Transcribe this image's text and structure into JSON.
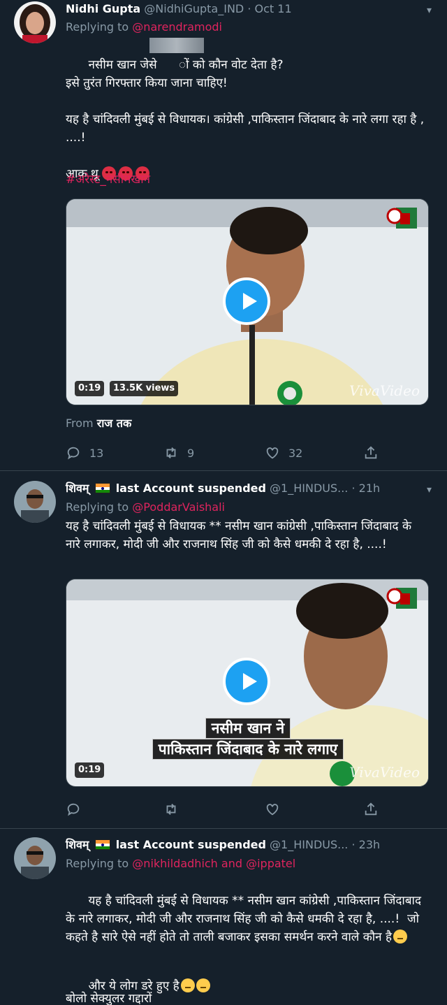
{
  "tweets": [
    {
      "name": "Nidhi Gupta",
      "handle": "@NidhiGupta_IND",
      "sep": "·",
      "time": "Oct 11",
      "replying_prefix": "Replying to ",
      "replying_to": "@narendramodi",
      "text1": "नसीम खान जेसे      ों को कौन वोट देता है?\nइसे तुरंत गिरफ्तार किया जाना चाहिए!\n\nयह है चांदिवली मुंबई से विधायक। कांग्रेसी ,पाकिस्तान जिंदाबाद के नारे लगा रहा है , ....!\n\nआक थू ",
      "hashtag": "#अरेस्ट_नसीमखान",
      "video": {
        "duration": "0:19",
        "views": "13.5K views",
        "watermark": "VivaVideo"
      },
      "from_prefix": "From ",
      "from_source": "राज तक",
      "actions": {
        "replies": "13",
        "retweets": "9",
        "likes": "32"
      }
    },
    {
      "name": "शिवम्",
      "suffix": "last Account suspended",
      "handle": "@1_HINDUS...",
      "sep": "·",
      "time": "21h",
      "replying_prefix": "Replying to ",
      "replying_to": "@PoddarVaishali",
      "text1": "यह है चांदिवली मुंबई से विधायक ** नसीम खान कांग्रेसी ,पाकिस्तान जिंदाबाद के नारे लगाकर, मोदी जी और राजनाथ सिंह जी को कैसे धमकी दे रहा है, ....!",
      "video": {
        "duration": "0:19",
        "caption_line1": "नसीम खान ने",
        "caption_line2": "पाकिस्तान जिंदाबाद के नारे लगाए",
        "watermark": "VivaVideo"
      },
      "actions": {
        "replies": "",
        "retweets": "",
        "likes": ""
      }
    },
    {
      "name": "शिवम्",
      "suffix": "last Account suspended",
      "handle": "@1_HINDUS...",
      "sep": "·",
      "time": "23h",
      "replying_prefix": "Replying to ",
      "replying_to": "@nikhildadhich and @ippatel",
      "text1": "यह है चांदिवली मुंबई से विधायक ** नसीम खान कांग्रेसी ,पाकिस्तान जिंदाबाद के नारे लगाकर, मोदी जी और राजनाथ सिंह जी को कैसे धमकी दे रहा है, ....!  जो कहते है सारे ऐसे नहीं होते तो ताली बजाकर इसका समर्थन करने वाले कौन है",
      "text2": "और ये लोग डरे हुए है",
      "text3": "बोलो सेक्युलर गद्दारों"
    }
  ],
  "colors": {
    "background": "#15202b",
    "muted": "#8899a6",
    "accent": "#e0245e",
    "play": "#1da1f2",
    "divider": "#38444d"
  },
  "icons": [
    "reply-icon",
    "retweet-icon",
    "like-icon",
    "share-icon",
    "chevron-down-icon",
    "play-icon",
    "india-flag-icon",
    "angry-face-icon",
    "thinking-face-icon"
  ]
}
